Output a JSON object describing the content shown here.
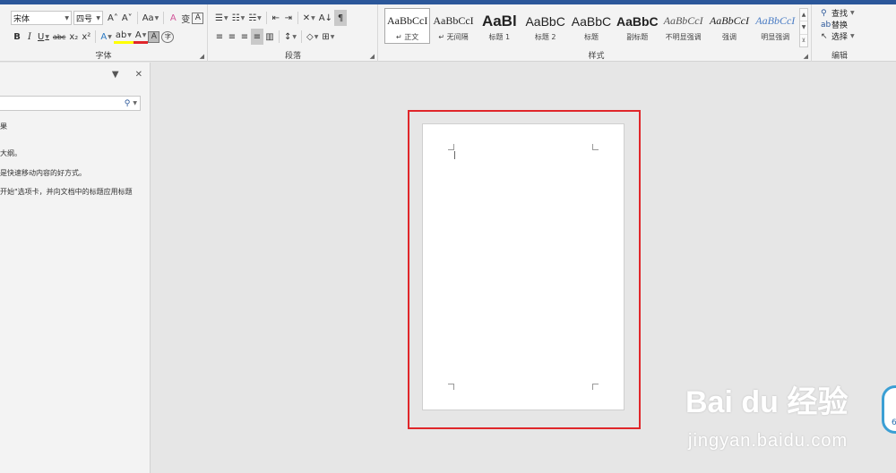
{
  "ribbon": {
    "font": {
      "label": "字体",
      "font_name": "宋体",
      "font_size": "四号",
      "grow": "A˄",
      "shrink": "A˅",
      "change_case": "Aa",
      "clear_format": "A",
      "phonetic": "变",
      "char_border": "A",
      "bold": "B",
      "italic": "I",
      "underline": "U",
      "strikethrough": "abc",
      "subscript": "x₂",
      "superscript": "x²",
      "text_effects": "A",
      "highlight": "ab",
      "font_color": "A",
      "char_shading": "A",
      "enclose": "字"
    },
    "paragraph": {
      "label": "段落",
      "bullets": "☰",
      "numbering": "☷",
      "multilevel": "☵",
      "decrease_indent": "⇤",
      "increase_indent": "⇥",
      "chinese_layout": "✕",
      "sort": "A↓",
      "show_marks": "¶",
      "align_left": "≡",
      "align_center": "≡",
      "align_right": "≡",
      "justify": "≡",
      "distribute": "▥",
      "line_spacing": "↕",
      "shading": "◇",
      "borders": "⊞"
    },
    "styles": {
      "label": "样式",
      "items": [
        {
          "sample": "AaBbCcI",
          "name": "↵ 正文"
        },
        {
          "sample": "AaBbCcI",
          "name": "↵ 无间隔"
        },
        {
          "sample": "AaBl",
          "name": "标题 1"
        },
        {
          "sample": "AaBbC",
          "name": "标题 2"
        },
        {
          "sample": "AaBbC",
          "name": "标题"
        },
        {
          "sample": "AaBbC",
          "name": "副标题"
        },
        {
          "sample": "AaBbCcI",
          "name": "不明显强调"
        },
        {
          "sample": "AaBbCcI",
          "name": "强调"
        },
        {
          "sample": "AaBbCcI",
          "name": "明显强调"
        }
      ]
    },
    "editing": {
      "label": "编辑",
      "find": "查找",
      "replace": "替换",
      "select": "选择"
    }
  },
  "nav_pane": {
    "search_icon": "search-icon",
    "lines": [
      "果",
      "大纲。",
      "是快速移动内容的好方式。",
      "开始\"选项卡，并向文档中的标题应用标题"
    ]
  },
  "watermark": {
    "logo": "Bai du 经验",
    "url": "jingyan.baidu.com",
    "badge": "6"
  },
  "colors": {
    "title_bar": "#2b579a",
    "highlight_border": "#e0262a",
    "font_color_red": "#e0262a",
    "highlighter_yellow": "#ffff00"
  }
}
